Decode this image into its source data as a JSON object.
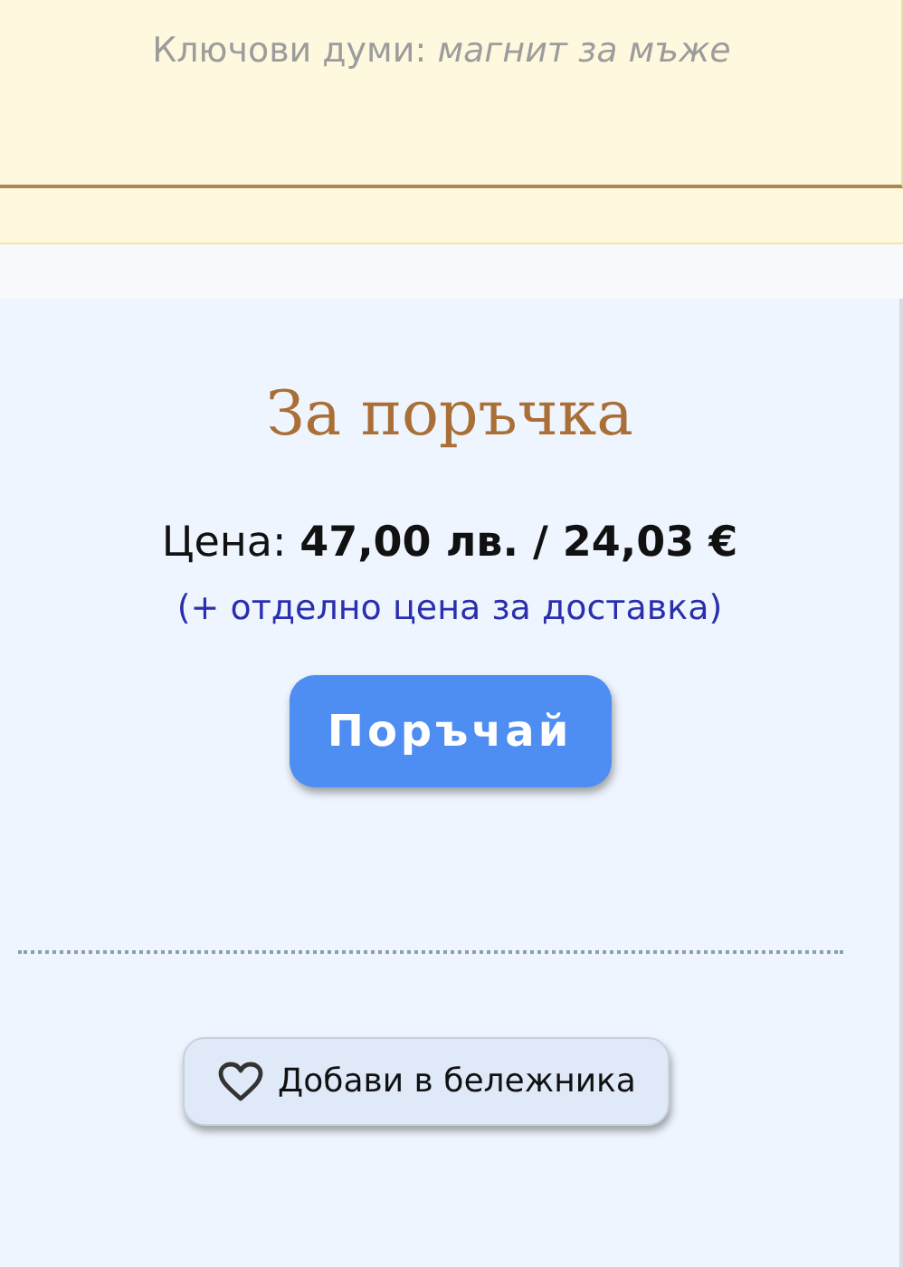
{
  "keywords": "Ключови думи: *магнит за мъже*",
  "order": {
    "title": "За поръчка",
    "price": "Цена: **47,00 лв. / 24,03 €**",
    "delivery_note": "(+ отделно цена за доставка)",
    "order_button": "Поръчай"
  },
  "bookmark_button": "Добави в бележника"
}
